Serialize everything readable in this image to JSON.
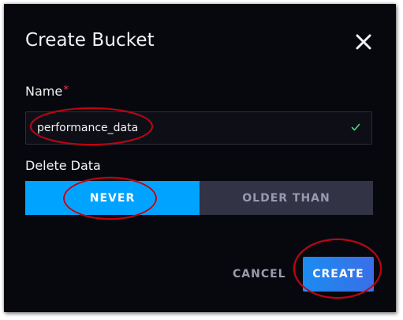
{
  "dialog": {
    "title": "Create Bucket",
    "close_icon": "close-icon"
  },
  "name_field": {
    "label": "Name",
    "required_marker": "*",
    "value": "performance_data",
    "valid_icon": "check-icon"
  },
  "delete_data": {
    "label": "Delete Data",
    "options": [
      "NEVER",
      "OLDER THAN"
    ],
    "selected": "NEVER"
  },
  "actions": {
    "cancel_label": "CANCEL",
    "create_label": "CREATE"
  },
  "colors": {
    "background": "#07070e",
    "accent": "#00a3ff",
    "required": "#e0374a",
    "valid": "#4ed87a",
    "annotation": "#c6000f"
  }
}
